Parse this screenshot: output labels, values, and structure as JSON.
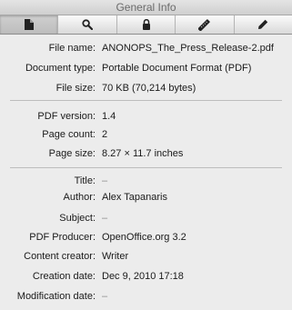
{
  "window": {
    "title": "General Info"
  },
  "toolbar": {
    "buttons": [
      {
        "icon": "document-icon",
        "active": true
      },
      {
        "icon": "search-icon",
        "active": false
      },
      {
        "icon": "lock-icon",
        "active": false
      },
      {
        "icon": "ruler-icon",
        "active": false
      },
      {
        "icon": "pencil-icon",
        "active": false
      }
    ]
  },
  "info": {
    "file_name": {
      "label": "File name:",
      "value": "ANONOPS_The_Press_Release-2.pdf"
    },
    "document_type": {
      "label": "Document type:",
      "value": "Portable Document Format (PDF)"
    },
    "file_size": {
      "label": "File size:",
      "value": "70 KB (70,214 bytes)"
    },
    "pdf_version": {
      "label": "PDF version:",
      "value": "1.4"
    },
    "page_count": {
      "label": "Page count:",
      "value": "2"
    },
    "page_size": {
      "label": "Page size:",
      "value": "8.27 × 11.7 inches"
    },
    "title": {
      "label": "Title:",
      "value": "–"
    },
    "author": {
      "label": "Author:",
      "value": "Alex Tapanaris"
    },
    "subject": {
      "label": "Subject:",
      "value": "–"
    },
    "pdf_producer": {
      "label": "PDF Producer:",
      "value": "OpenOffice.org 3.2"
    },
    "content_creator": {
      "label": "Content creator:",
      "value": "Writer"
    },
    "creation_date": {
      "label": "Creation date:",
      "value": "Dec 9, 2010 17:18"
    },
    "modification_date": {
      "label": "Modification date:",
      "value": "–"
    }
  }
}
